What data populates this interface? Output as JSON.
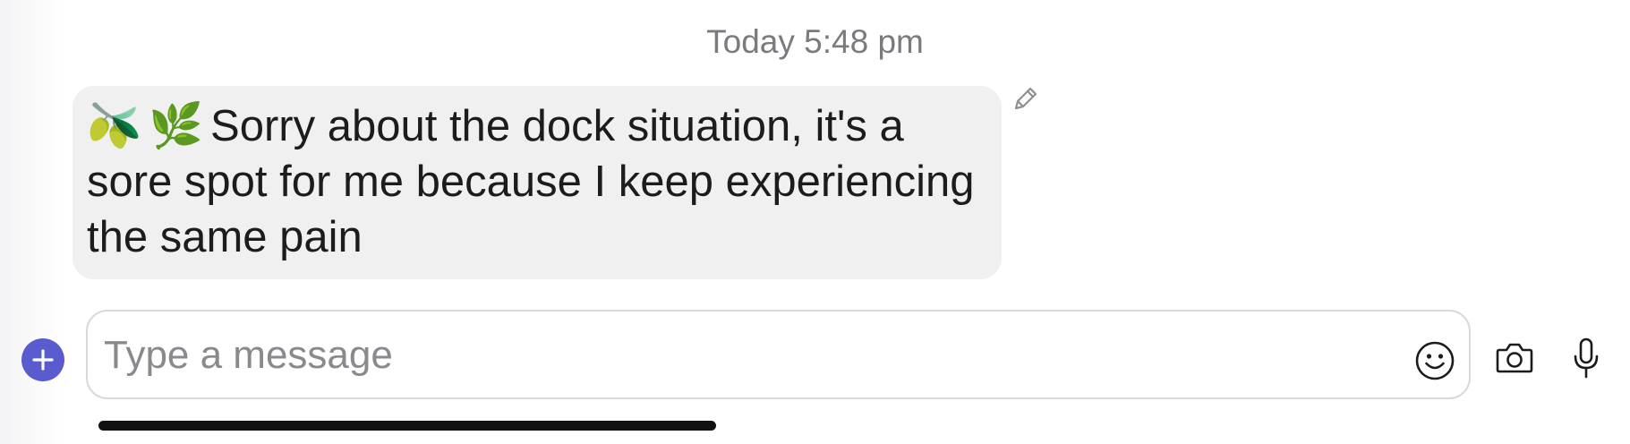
{
  "chat": {
    "timestamp": "Today 5:48 pm",
    "message": {
      "emojis": [
        "🫒",
        "🌿"
      ],
      "lines": [
        "Sorry about the dock situation, it's a",
        "sore spot for me because I keep experiencing",
        "the same pain"
      ]
    }
  },
  "composer": {
    "placeholder": "Type a message",
    "value": ""
  },
  "icons": {
    "edit": "pencil-icon",
    "add": "plus-icon",
    "emoji": "smiley-icon",
    "camera": "camera-icon",
    "microphone": "microphone-icon"
  },
  "colors": {
    "accent": "#5b5bd0",
    "bubble": "#f0f0f0",
    "timestamp": "#7a7a7f"
  }
}
